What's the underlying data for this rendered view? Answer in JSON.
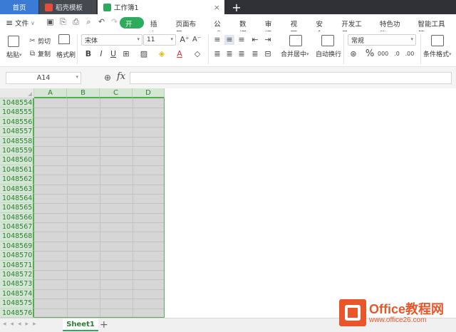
{
  "tabs": {
    "home": "首页",
    "template": "稻壳模板",
    "workbook": "工作簿1",
    "new_tab": "+"
  },
  "menu": {
    "file": "文件",
    "tabs": [
      "开始",
      "插入",
      "页面布局",
      "公式",
      "数据",
      "审阅",
      "视图",
      "安全",
      "开发工具",
      "特色功能",
      "智能工具箱"
    ],
    "active": "开始"
  },
  "ribbon": {
    "paste": "粘贴",
    "cut": "剪切",
    "copy": "复制",
    "format_painter": "格式刷",
    "font_name": "宋体",
    "font_size": "11",
    "merge_center": "合并居中",
    "auto_wrap": "自动换行",
    "number_format": "常规",
    "conditional_format": "条件格式"
  },
  "formula_bar": {
    "cell_ref": "A14",
    "fx": "fx",
    "content": ""
  },
  "grid": {
    "columns": [
      "A",
      "B",
      "C",
      "D"
    ],
    "rows": [
      "1048554",
      "1048555",
      "1048556",
      "1048557",
      "1048558",
      "1048559",
      "1048560",
      "1048561",
      "1048562",
      "1048563",
      "1048564",
      "1048565",
      "1048566",
      "1048567",
      "1048568",
      "1048569",
      "1048570",
      "1048571",
      "1048572",
      "1048573",
      "1048574",
      "1048575",
      "1048576"
    ]
  },
  "sheets": {
    "active": "Sheet1",
    "add": "+"
  },
  "watermark": {
    "title": "Office教程网",
    "url": "www.office26.com"
  },
  "colors": {
    "accent": "#2cab5c",
    "selection_header": "#d4e6d4",
    "selection_border": "#57a857",
    "cell_fill": "#d6d6d6"
  }
}
